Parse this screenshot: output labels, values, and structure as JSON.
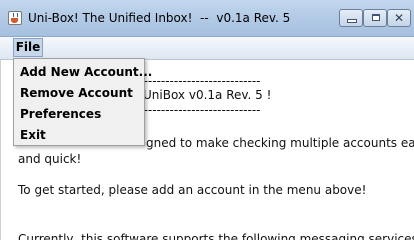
{
  "window": {
    "title": "Uni-Box! The Unified Inbox!  --  v0.1a Rev. 5",
    "controls": {
      "close_glyph": "✕"
    }
  },
  "menubar": {
    "file_label": "File",
    "file_menu_items": [
      "Add New Account...",
      "Remove Account",
      "Preferences",
      "Exit"
    ]
  },
  "content": {
    "divider_line": "--------------------------------------------------------",
    "welcome_visible_text": "UniBox v0.1a Rev. 5 !",
    "intro_line_1": "gned to make checking multiple accounts easy",
    "intro_line_2": "and quick!",
    "get_started": "To get started, please add an account in the menu above!",
    "support_line": "Currently, this software supports the following messaging services:"
  },
  "colors": {
    "titlebar": "#b3cbe6",
    "menu_highlight": "#c7d7ea",
    "dropdown_bg": "#f0f0f0"
  }
}
